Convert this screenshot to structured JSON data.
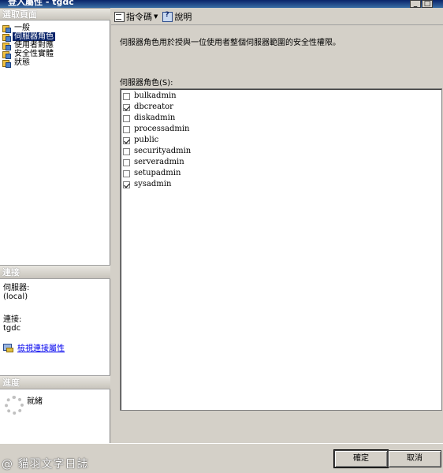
{
  "window": {
    "title": "登入屬性 - tgdc",
    "min_glyph": "_",
    "max_glyph": "□"
  },
  "left": {
    "select_page_header": "選取頁面",
    "pages": [
      {
        "label": "一般",
        "selected": false
      },
      {
        "label": "伺服器角色",
        "selected": true
      },
      {
        "label": "使用者對應",
        "selected": false
      },
      {
        "label": "安全性實體",
        "selected": false
      },
      {
        "label": "狀態",
        "selected": false
      }
    ],
    "connection_header": "連接",
    "server_label": "伺服器:",
    "server_value": "(local)",
    "connection_label": "連接:",
    "connection_value": "tgdc",
    "view_connection_link": "檢視連接屬性",
    "progress_header": "進度",
    "progress_status": "就緒"
  },
  "toolbar": {
    "script_label": "指令碼",
    "help_label": "說明",
    "dropdown_glyph": "▼"
  },
  "main": {
    "description": "伺服器角色用於授與一位使用者整個伺服器範圍的安全性權限。",
    "list_label": "伺服器角色(S):",
    "roles": [
      {
        "name": "bulkadmin",
        "checked": false
      },
      {
        "name": "dbcreator",
        "checked": true
      },
      {
        "name": "diskadmin",
        "checked": false
      },
      {
        "name": "processadmin",
        "checked": false
      },
      {
        "name": "public",
        "checked": true
      },
      {
        "name": "securityadmin",
        "checked": false
      },
      {
        "name": "serveradmin",
        "checked": false
      },
      {
        "name": "setupadmin",
        "checked": false
      },
      {
        "name": "sysadmin",
        "checked": true
      }
    ]
  },
  "buttons": {
    "ok": "確定",
    "cancel": "取消"
  },
  "watermark": "@ 貓羽文字日誌"
}
